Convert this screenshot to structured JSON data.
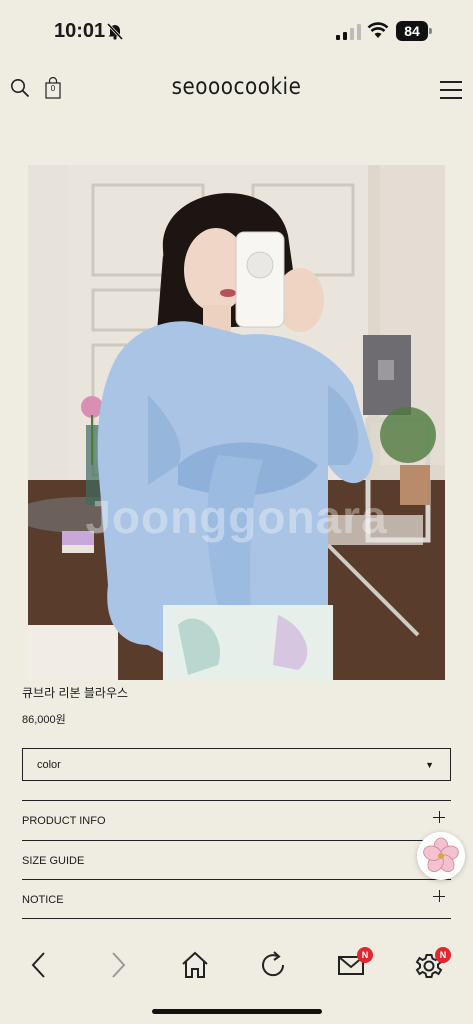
{
  "status_bar": {
    "time": "10:01",
    "battery": "84",
    "icons": [
      "bell-off-icon",
      "signal-icon",
      "wifi-icon",
      "battery-icon"
    ]
  },
  "header": {
    "logo": "seooocookie",
    "cart_count": "0",
    "icons": [
      "search-icon",
      "cart-icon",
      "menu-icon"
    ]
  },
  "product": {
    "watermark": "Joonggonara",
    "name": "큐브라 리본 블라우스",
    "price": "86,000원",
    "option": {
      "selected": "color",
      "arrow": "▼"
    }
  },
  "accordions": [
    {
      "label": "PRODUCT INFO"
    },
    {
      "label": "SIZE GUIDE"
    },
    {
      "label": "NOTICE"
    }
  ],
  "toolbar": {
    "items": [
      "back-icon",
      "forward-icon",
      "home-icon",
      "reload-icon",
      "mail-icon",
      "settings-icon"
    ],
    "mail_badge": "N",
    "settings_badge": "N"
  },
  "colors": {
    "background": "#efede2",
    "badge": "#e6262e",
    "shirt": "#a9c4e4"
  }
}
